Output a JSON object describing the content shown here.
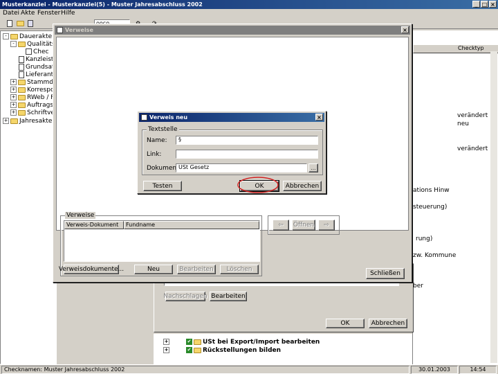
{
  "app": {
    "title": "Musterkanzlei - Musterkanzlei(5) - Muster Jahresabschluss 2002",
    "menu": [
      "Datei",
      "Akte",
      "Fenster",
      "Hilfe"
    ],
    "toolbar_combo": "ooco"
  },
  "tree": {
    "items": [
      {
        "label": "Dauerakte"
      },
      {
        "label": "Qualitätsm"
      },
      {
        "label": "Chec"
      },
      {
        "label": "Kanzleistan"
      },
      {
        "label": "Grundsatzd"
      },
      {
        "label": "Lieferanten"
      },
      {
        "label": "Stammdat"
      },
      {
        "label": "Korrespon"
      },
      {
        "label": "RWeb / Fil"
      },
      {
        "label": "Auftragsw"
      },
      {
        "label": "Schriftverk"
      },
      {
        "label": "Jahresakte"
      }
    ]
  },
  "right_panel": {
    "column_header": "Checktyp",
    "entries": [
      "verändert",
      "neu",
      "verändert"
    ],
    "fragments": [
      "ations Hinw",
      "steuerung)",
      "rung)",
      "zw. Kommune",
      "ber"
    ]
  },
  "verweise": {
    "title": "Verweise",
    "group_label": "Verweise",
    "table_headers": [
      "Verweis-Dokument",
      "Fundname"
    ],
    "buttons": {
      "verweisdokumente": "Verweisdokumente...",
      "neu": "Neu",
      "bearbeiten": "Bearbeiten",
      "loeschen": "Löschen",
      "oeffnen": "Öffnen",
      "schliessen": "Schließen"
    }
  },
  "dialog": {
    "title": "Verweis neu",
    "group_label": "Textstelle",
    "name_label": "Name:",
    "name_value": "§",
    "link_label": "Link:",
    "link_value": "",
    "dokument_label": "Dokument:",
    "dokument_value": "USt Gesetz",
    "buttons": {
      "testen": "Testen",
      "ok": "OK",
      "abbrechen": "Abbrechen"
    }
  },
  "lower_panel": {
    "buttons": {
      "nachschlagen": "Nachschlagen",
      "bearbeiten": "Bearbeiten",
      "ok": "OK",
      "abbrechen": "Abbrechen"
    },
    "tree_items": [
      "USt bei Export/Import bearbeiten",
      "Rückstellungen bilden"
    ]
  },
  "statusbar": {
    "left": "Checknamen: Muster Jahresabschluss 2002",
    "date": "30.01.2003",
    "time": "14:54"
  },
  "colors": {
    "highlight_circle": "#d22020",
    "title_active": "#0a246a"
  }
}
